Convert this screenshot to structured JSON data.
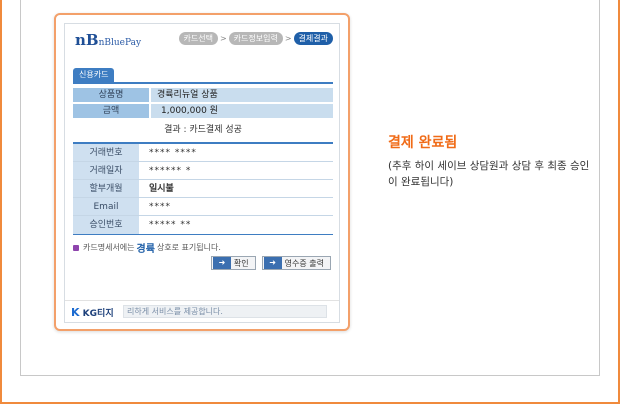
{
  "popup": {
    "logo": {
      "big": "nB",
      "text": "nBluePay"
    },
    "steps": [
      {
        "label": "카드선택"
      },
      {
        "label": "카드정보입력"
      },
      {
        "label": "결제결과"
      }
    ],
    "tab_label": "신용카드",
    "summary": {
      "product_label": "상품명",
      "product_value": "경륙리뉴얼 상품",
      "amount_label": "금액",
      "amount_value": "1,000,000 원",
      "result_text": "결과 : 카드결제 성공"
    },
    "details": [
      {
        "label": "거래번호",
        "value": "**** ****"
      },
      {
        "label": "거래일자",
        "value": "****** *"
      },
      {
        "label": "할부개월",
        "value": "일시불"
      },
      {
        "label": "Email",
        "value": "****"
      },
      {
        "label": "승인번호",
        "value": "***** **"
      }
    ],
    "notice": {
      "prefix": "카드명세서에는",
      "highlight": "경륙",
      "suffix": "상호로 표기됩니다."
    },
    "buttons": {
      "confirm": "확인",
      "receipt": "영수증 출력"
    },
    "footer": {
      "logo_k": "K",
      "logo_text": "KG티지",
      "text": "리하게 서비스를 제공합니다."
    }
  },
  "status": {
    "title": "결제 완료됨",
    "description": "(추후 하이 세이브 상담원과 상담 후 최종 승인이 완료됩니다)"
  },
  "colors": {
    "accent_orange": "#f06b17",
    "frame_orange": "#f08a3c",
    "primary_blue": "#1f5fa8"
  }
}
